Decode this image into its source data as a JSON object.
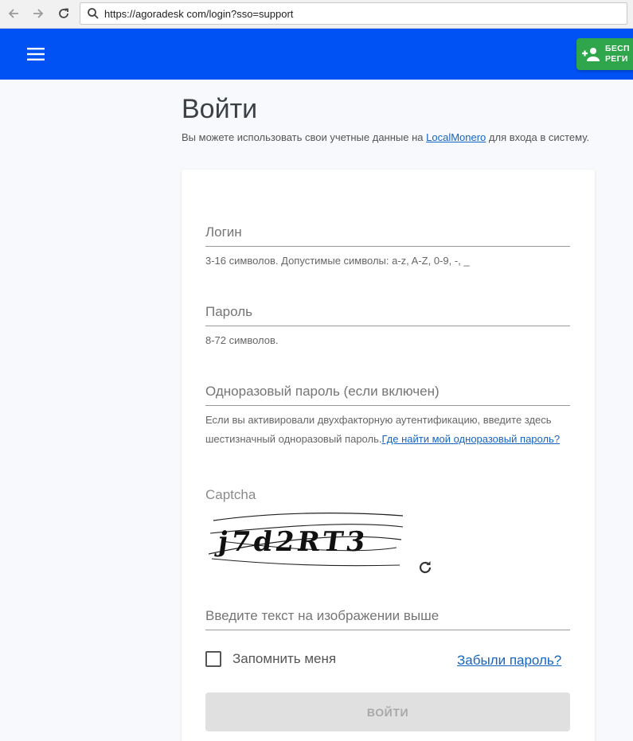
{
  "browser": {
    "url": "https://agoradesk com/login?sso=support"
  },
  "appbar": {
    "register_label": "БЕСП\nРЕГИ",
    "brand_color": "#0152f5",
    "register_color": "#2fa64b"
  },
  "page": {
    "title": "Войти",
    "subtitle_before": "Вы можете использовать свои учетные данные на ",
    "subtitle_link": "LocalMonero",
    "subtitle_after": " для входа в систему."
  },
  "form": {
    "login": {
      "placeholder": "Логин",
      "helper": "3-16 символов. Допустимые символы: a-z, A-Z, 0-9, -, _"
    },
    "password": {
      "placeholder": "Пароль",
      "helper": "8-72 символов."
    },
    "otp": {
      "placeholder": "Одноразовый пароль (если включен)",
      "helper": "Если вы активировали двухфакторную аутентификацию, введите здесь шестизначный одноразовый пароль.",
      "helper_link": "Где найти мой одноразовый пароль?"
    },
    "captcha": {
      "label": "Captcha",
      "image_text": "j7d2RT3",
      "input_placeholder": "Введите текст на изображении выше"
    },
    "remember_label": "Запомнить меня",
    "forgot_label": "Забыли пароль?",
    "submit_label": "ВОЙТИ"
  }
}
